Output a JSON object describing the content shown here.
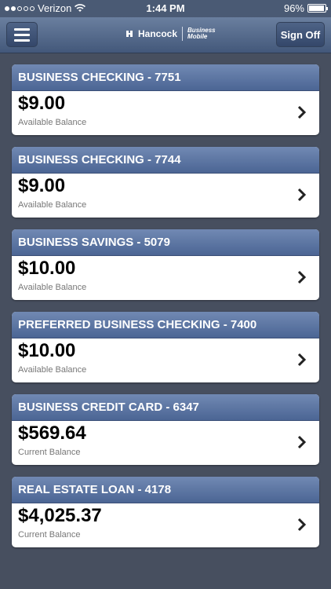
{
  "status_bar": {
    "carrier": "Verizon",
    "time": "1:44 PM",
    "battery": "96%",
    "battery_level": 0.96
  },
  "header": {
    "logo_name": "Hancock",
    "logo_sub": "Business Mobile",
    "sign_off_label": "Sign Off"
  },
  "accounts": [
    {
      "title": "BUSINESS CHECKING - 7751",
      "balance": "$9.00",
      "balance_label": "Available Balance"
    },
    {
      "title": "BUSINESS CHECKING - 7744",
      "balance": "$9.00",
      "balance_label": "Available Balance"
    },
    {
      "title": "BUSINESS SAVINGS - 5079",
      "balance": "$10.00",
      "balance_label": "Available Balance"
    },
    {
      "title": "PREFERRED BUSINESS CHECKING - 7400",
      "balance": "$10.00",
      "balance_label": "Available Balance"
    },
    {
      "title": "BUSINESS CREDIT CARD - 6347",
      "balance": "$569.64",
      "balance_label": "Current Balance"
    },
    {
      "title": "REAL ESTATE LOAN - 4178",
      "balance": "$4,025.37",
      "balance_label": "Current Balance"
    }
  ]
}
